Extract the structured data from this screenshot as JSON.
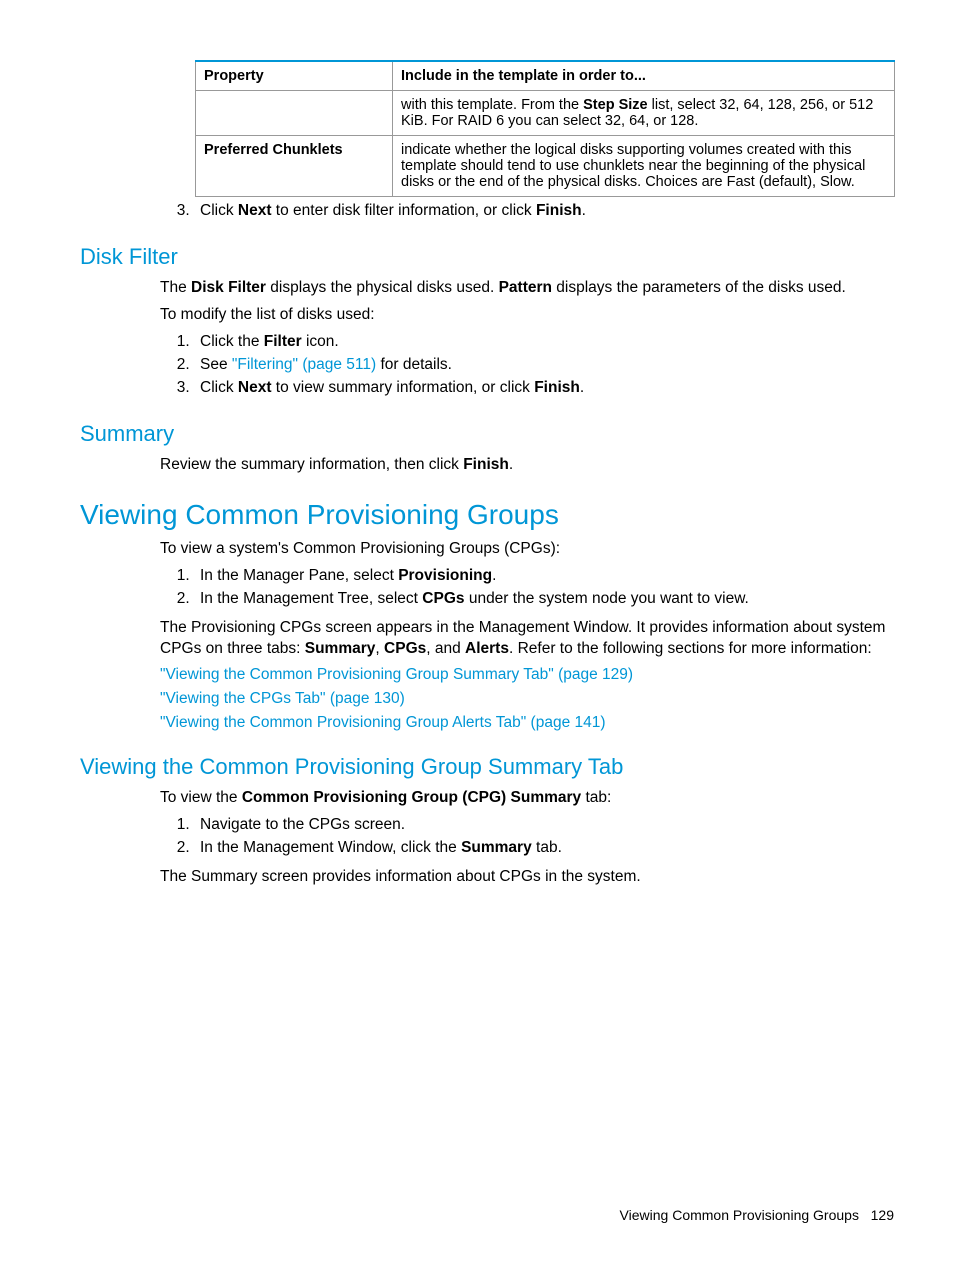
{
  "table": {
    "headers": [
      "Property",
      "Include in the template in order to..."
    ],
    "rows": [
      {
        "property": "",
        "desc_parts": [
          "with this template. From the ",
          "Step Size",
          " list, select 32, 64, 128, 256, or 512 KiB. For RAID 6 you can select 32, 64, or 128."
        ]
      },
      {
        "property": "Preferred Chunklets",
        "desc_parts": [
          "indicate whether the logical disks supporting volumes created with this template should tend to use chunklets near the beginning of the physical disks or the end of the physical disks. Choices are Fast (default), Slow."
        ]
      }
    ]
  },
  "step3_pre": {
    "num": "3.",
    "parts": [
      "Click ",
      "Next",
      " to enter disk filter information, or click ",
      "Finish",
      "."
    ]
  },
  "disk_filter": {
    "heading": "Disk Filter",
    "intro_parts": [
      "The ",
      "Disk Filter",
      " displays the physical disks used. ",
      "Pattern",
      " displays the parameters of the disks used."
    ],
    "modify": "To modify the list of disks used:",
    "steps": [
      {
        "parts": [
          "Click the ",
          "Filter",
          " icon."
        ]
      },
      {
        "parts": [
          "See ",
          "\"Filtering\" (page 511)",
          " for details."
        ],
        "link_index": 1
      },
      {
        "parts": [
          "Click ",
          "Next",
          " to view summary information, or click ",
          "Finish",
          "."
        ]
      }
    ]
  },
  "summary": {
    "heading": "Summary",
    "text_parts": [
      "Review the summary information, then click ",
      "Finish",
      "."
    ]
  },
  "viewing_cpg": {
    "heading": "Viewing Common Provisioning Groups",
    "intro": "To view a system's Common Provisioning Groups (CPGs):",
    "steps": [
      {
        "parts": [
          "In the Manager Pane, select ",
          "Provisioning",
          "."
        ]
      },
      {
        "parts": [
          "In the Management Tree, select ",
          "CPGs",
          " under the system node you want to view."
        ]
      }
    ],
    "para_parts": [
      "The Provisioning CPGs screen appears in the Management Window. It provides information about system CPGs on three tabs: ",
      "Summary",
      ", ",
      "CPGs",
      ", and ",
      "Alerts",
      ". Refer to the following sections for more information:"
    ],
    "links": [
      "\"Viewing the Common Provisioning Group Summary Tab\" (page 129)",
      "\"Viewing the CPGs Tab\" (page 130)",
      "\"Viewing the Common Provisioning Group Alerts Tab\" (page 141)"
    ]
  },
  "viewing_summary_tab": {
    "heading": "Viewing the Common Provisioning Group Summary Tab",
    "intro_parts": [
      "To view the ",
      "Common Provisioning Group (CPG) Summary",
      " tab:"
    ],
    "steps": [
      {
        "parts": [
          "Navigate to the CPGs screen."
        ]
      },
      {
        "parts": [
          "In the Management Window, click the ",
          "Summary",
          " tab."
        ]
      }
    ],
    "closing": "The Summary screen provides information about CPGs in the system."
  },
  "footer": {
    "text": "Viewing Common Provisioning Groups",
    "page": "129"
  }
}
